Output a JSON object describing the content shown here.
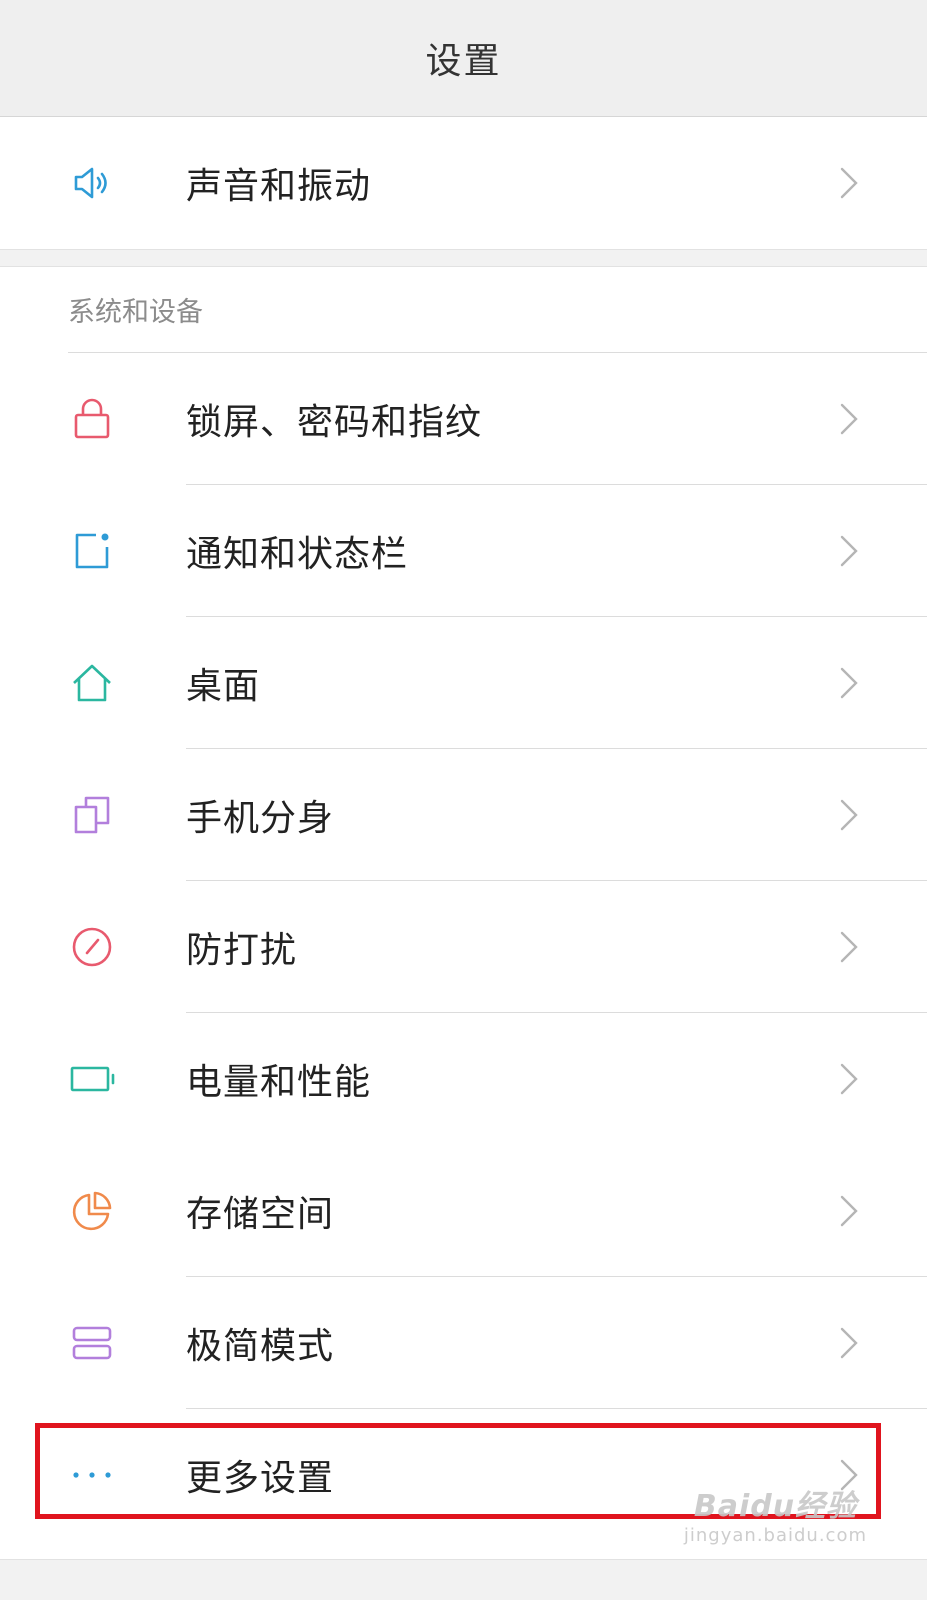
{
  "header": {
    "title": "设置"
  },
  "sound_item": {
    "label": "声音和振动",
    "icon": "speaker-icon",
    "color": "#2e9bd6"
  },
  "section": {
    "title": "系统和设备"
  },
  "items": [
    {
      "label": "锁屏、密码和指纹",
      "icon": "lock-icon",
      "color": "#e85a6e"
    },
    {
      "label": "通知和状态栏",
      "icon": "notification-icon",
      "color": "#2e9bd6"
    },
    {
      "label": "桌面",
      "icon": "home-icon",
      "color": "#2bb7a0"
    },
    {
      "label": "手机分身",
      "icon": "copy-icon",
      "color": "#b27fdc"
    },
    {
      "label": "防打扰",
      "icon": "do-not-disturb-icon",
      "color": "#e85a6e"
    },
    {
      "label": "电量和性能",
      "icon": "battery-icon",
      "color": "#2bb7a0"
    },
    {
      "label": "存储空间",
      "icon": "pie-chart-icon",
      "color": "#f08a4b"
    },
    {
      "label": "极简模式",
      "icon": "simple-mode-icon",
      "color": "#b27fdc"
    },
    {
      "label": "更多设置",
      "icon": "more-dots-icon",
      "color": "#2e9bd6"
    }
  ],
  "chevron_color": "#b5b5b5",
  "highlight_color": "#e0141e",
  "watermark": {
    "main": "Baidu经验",
    "sub": "jingyan.baidu.com"
  }
}
